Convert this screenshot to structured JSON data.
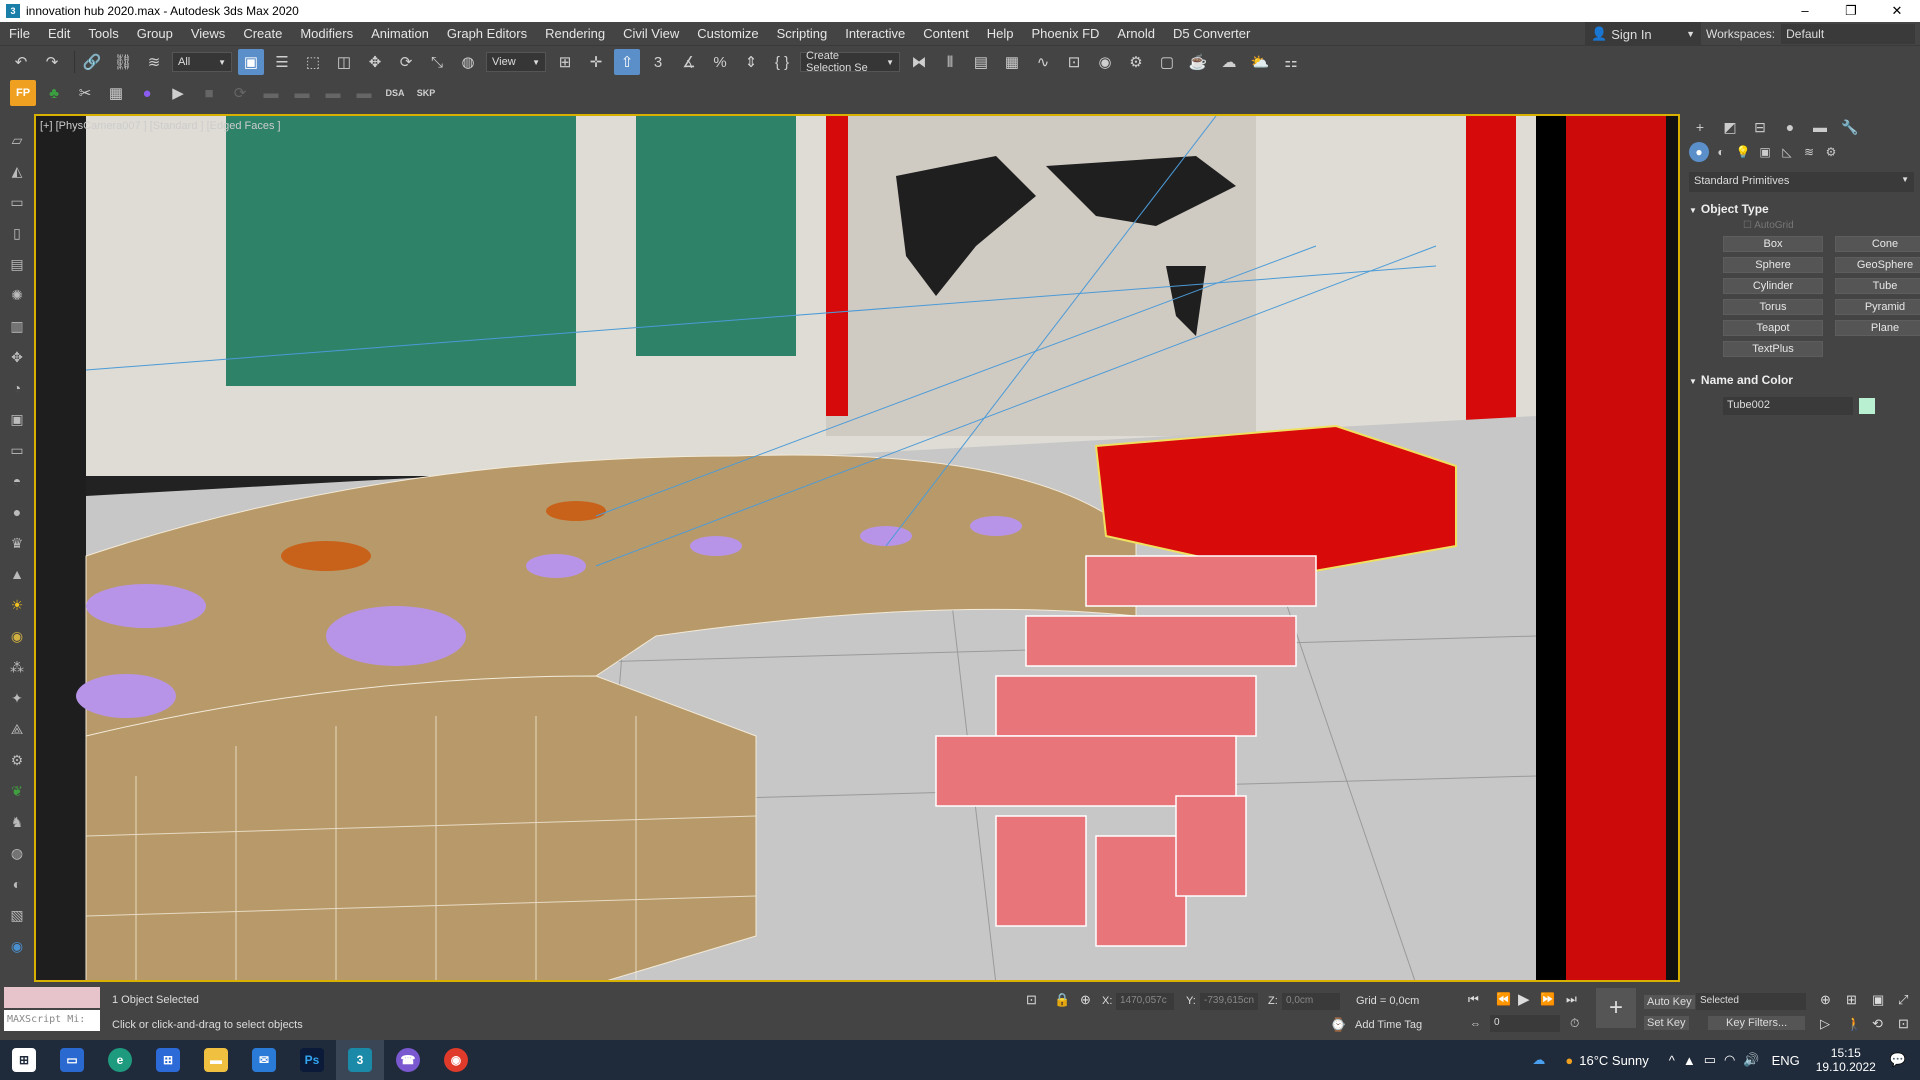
{
  "window": {
    "title": "innovation  hub  2020.max - Autodesk 3ds Max 2020",
    "minimize": "–",
    "maximize": "❐",
    "close": "✕"
  },
  "menu": {
    "items": [
      "File",
      "Edit",
      "Tools",
      "Group",
      "Views",
      "Create",
      "Modifiers",
      "Animation",
      "Graph Editors",
      "Rendering",
      "Civil View",
      "Customize",
      "Scripting",
      "Interactive",
      "Content",
      "Help",
      "Phoenix FD",
      "Arnold",
      "D5 Converter"
    ],
    "sign_in": "Sign In",
    "workspaces_label": "Workspaces:",
    "workspaces_value": "Default"
  },
  "toolbar": {
    "filter_value": "All",
    "refcoord_value": "View",
    "selection_set_value": "Create Selection Se"
  },
  "toolbar2": {
    "dsa": "DSA",
    "skp": "SKP"
  },
  "viewport": {
    "label": "[+] [PhysCamera007 ] [Standard ] [Edged Faces ]"
  },
  "command_panel": {
    "category": "Standard Primitives",
    "object_type_header": "Object Type",
    "autogrid": "AutoGrid",
    "buttons": [
      "Box",
      "Cone",
      "Sphere",
      "GeoSphere",
      "Cylinder",
      "Tube",
      "Torus",
      "Pyramid",
      "Teapot",
      "Plane",
      "TextPlus"
    ],
    "name_color_header": "Name and Color",
    "object_name": "Tube002",
    "object_color": "#b9f0d2"
  },
  "status": {
    "maxscript_placeholder": "MAXScript Mi:",
    "selected_count": "1 Object Selected",
    "prompt": "Click or click-and-drag to select objects",
    "x_label": "X:",
    "x_value": "1470,057c",
    "y_label": "Y:",
    "y_value": "-739,615cn",
    "z_label": "Z:",
    "z_value": "0,0cm",
    "grid": "Grid = 0,0cm",
    "add_time_tag": "Add Time Tag",
    "auto_key": "Auto Key",
    "set_key": "Set Key",
    "selected_dropdown": "Selected",
    "key_filters": "Key Filters...",
    "frame": "0"
  },
  "taskbar": {
    "weather": "16°C  Sunny",
    "language": "ENG",
    "time": "15:15",
    "date": "19.10.2022"
  }
}
